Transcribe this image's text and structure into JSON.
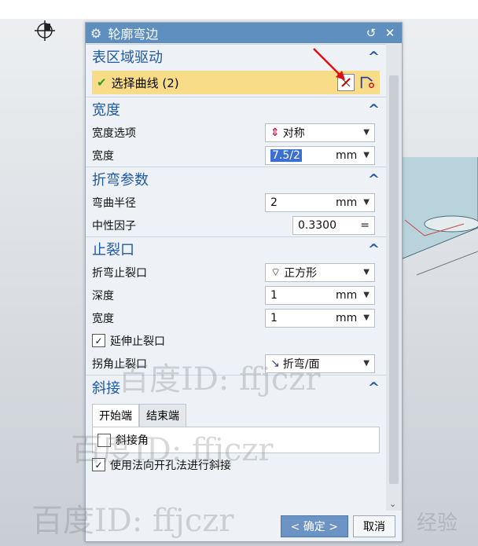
{
  "dialog": {
    "title": "轮廓弯边",
    "title_icon": "gear-icon",
    "reset_icon": "reset-icon",
    "close_icon": "close-icon"
  },
  "sections": {
    "surface": {
      "title": "表区域驱动",
      "select_label": "选择曲线 (2)"
    },
    "width": {
      "title": "宽度",
      "option_label": "宽度选项",
      "option_value": "对称",
      "width_label": "宽度",
      "width_value": "7.5/2",
      "width_unit": "mm"
    },
    "bend": {
      "title": "折弯参数",
      "radius_label": "弯曲半径",
      "radius_value": "2",
      "radius_unit": "mm",
      "neutral_label": "中性因子",
      "neutral_value": "0.3300",
      "neutral_suffix": "="
    },
    "relief": {
      "title": "止裂口",
      "bend_relief_label": "折弯止裂口",
      "bend_relief_value": "正方形",
      "depth_label": "深度",
      "depth_value": "1",
      "depth_unit": "mm",
      "width_label": "宽度",
      "width_value": "1",
      "width_unit": "mm",
      "extend_label": "延伸止裂口",
      "corner_label": "拐角止裂口",
      "corner_value": "折弯/面"
    },
    "miter": {
      "title": "斜接",
      "tab_start": "开始端",
      "tab_end": "结束端",
      "miter_angle_label": "斜接角",
      "normal_label": "使用法向开孔法进行斜接"
    }
  },
  "footer": {
    "ok_label": "< 确定 >",
    "cancel_label": "取消"
  },
  "watermarks": [
    "百度ID: ffjczr",
    "百度ID: ffjczr",
    "百度ID: ffjczr",
    "经验"
  ],
  "colors": {
    "title_bar": "#5f8fbf",
    "section_title": "#1f5aa6",
    "selected_row": "#f9dc87"
  }
}
